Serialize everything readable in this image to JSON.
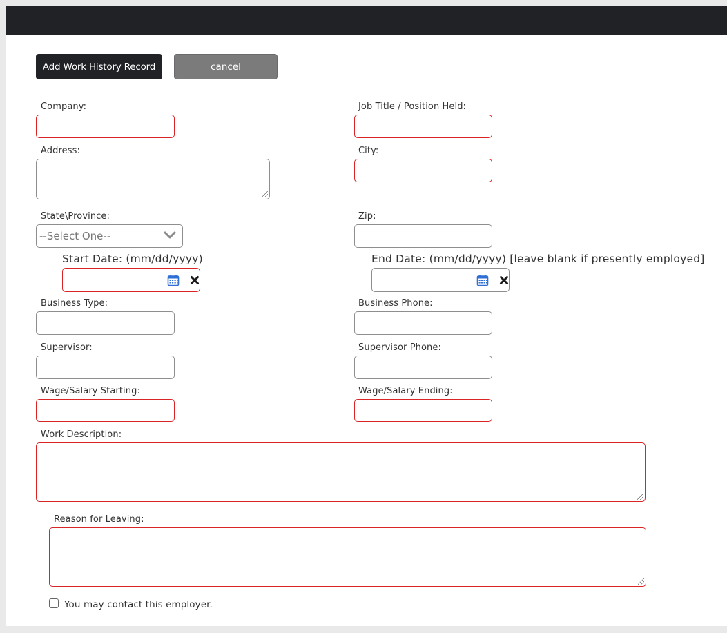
{
  "toolbar": {
    "add_label": "Add Work History Record",
    "cancel_label": "cancel"
  },
  "form": {
    "company_label": "Company:",
    "job_title_label": "Job Title / Position Held:",
    "address_label": "Address:",
    "city_label": "City:",
    "state_label": "State\\Province:",
    "state_selected": "--Select One--",
    "zip_label": "Zip:",
    "start_date_label": "Start Date: (mm/dd/yyyy)",
    "end_date_label": "End Date: (mm/dd/yyyy) [leave blank if presently employed]",
    "business_type_label": "Business Type:",
    "business_phone_label": "Business Phone:",
    "supervisor_label": "Supervisor:",
    "supervisor_phone_label": "Supervisor Phone:",
    "wage_start_label": "Wage/Salary Starting:",
    "wage_end_label": "Wage/Salary Ending:",
    "work_description_label": "Work Description:",
    "reason_leaving_label": "Reason for Leaving:",
    "contact_employer_label": "You may contact this employer."
  },
  "colors": {
    "required_border": "#d92525",
    "header_bar": "#212226",
    "calendar_icon": "#2f6fd6"
  },
  "icons": {
    "calendar": "calendar-icon",
    "clear": "close-icon",
    "dropdown": "chevron-down-icon"
  }
}
